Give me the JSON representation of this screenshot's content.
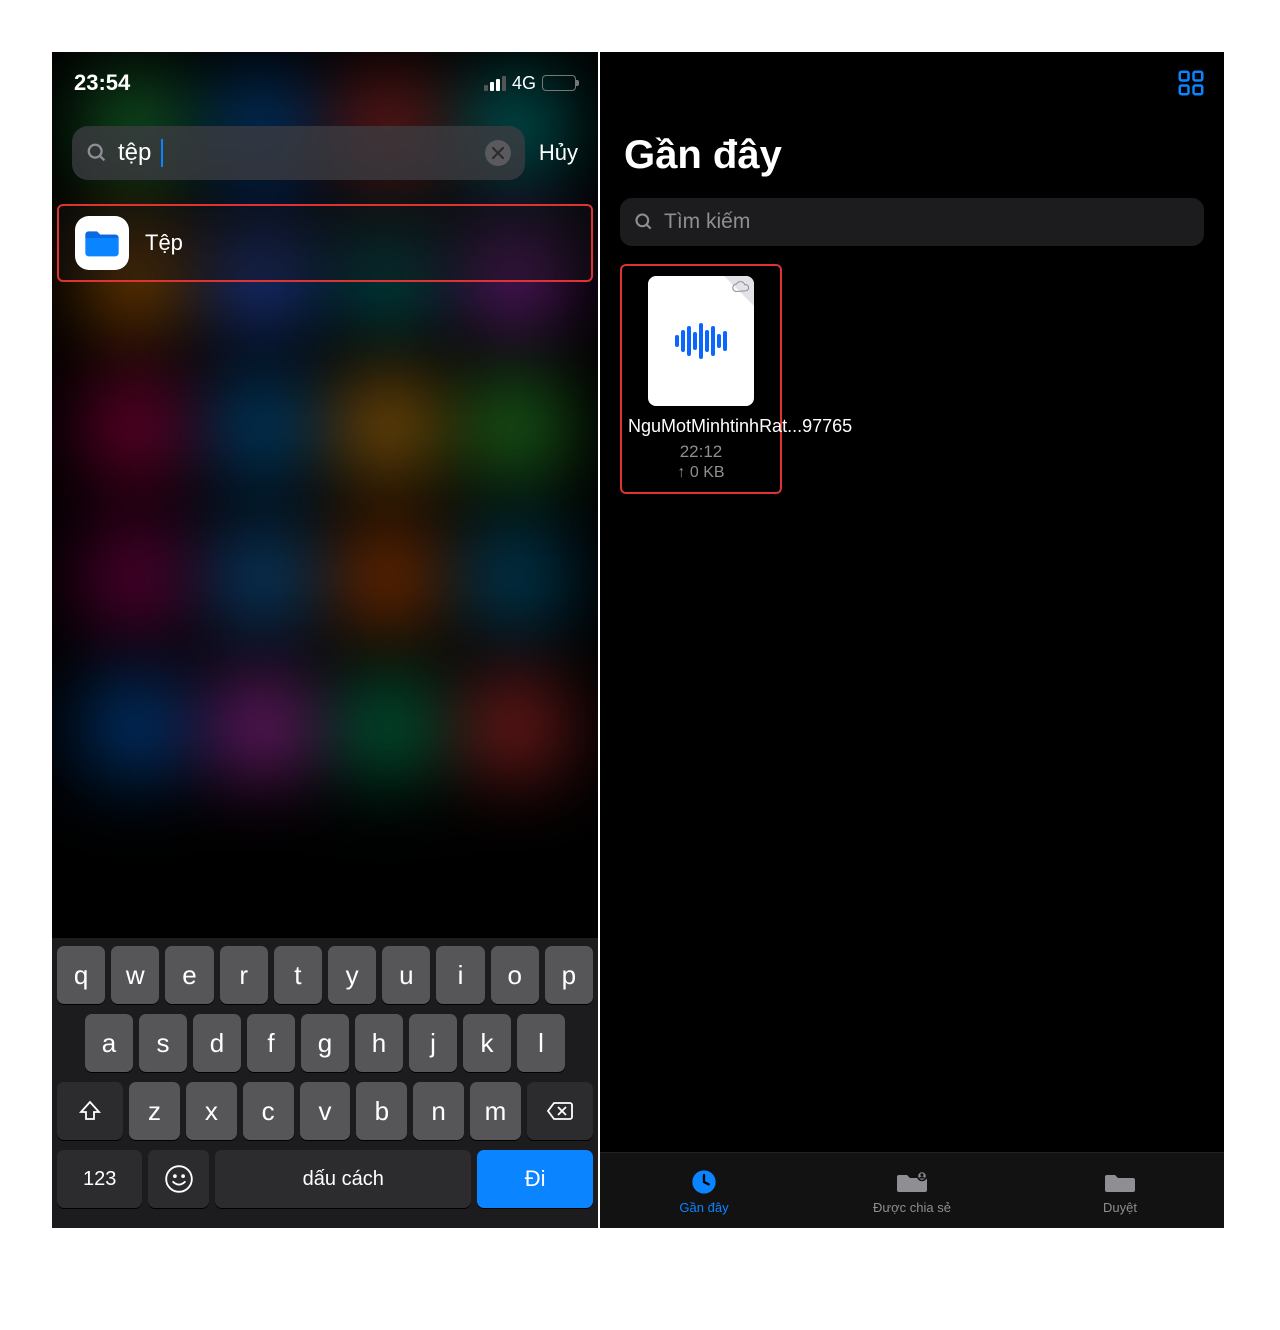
{
  "left": {
    "status": {
      "time": "23:54",
      "network": "4G"
    },
    "search": {
      "query": "tệp",
      "cancel": "Hủy"
    },
    "result": {
      "app_name": "Tệp"
    },
    "keyboard": {
      "row1": [
        "q",
        "w",
        "e",
        "r",
        "t",
        "y",
        "u",
        "i",
        "o",
        "p"
      ],
      "row2": [
        "a",
        "s",
        "d",
        "f",
        "g",
        "h",
        "j",
        "k",
        "l"
      ],
      "row3": [
        "z",
        "x",
        "c",
        "v",
        "b",
        "n",
        "m"
      ],
      "numbers": "123",
      "space": "dấu cách",
      "go": "Đi"
    }
  },
  "right": {
    "title": "Gần đây",
    "search_placeholder": "Tìm kiếm",
    "file": {
      "name": "NguMotMinhtinhRat...97765",
      "time": "22:12",
      "size": "↑ 0 KB"
    },
    "tabs": {
      "recent": "Gần đây",
      "shared": "Được chia sẻ",
      "browse": "Duyệt"
    }
  }
}
